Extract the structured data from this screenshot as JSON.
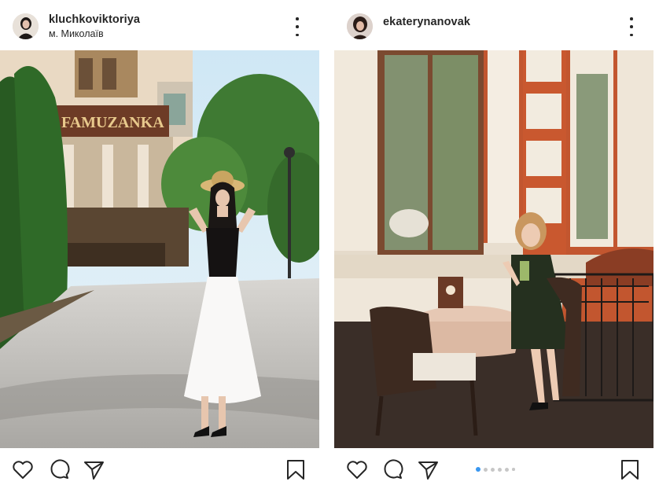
{
  "posts": [
    {
      "username": "kluchkoviktoriya",
      "location": "м. Миколаїв",
      "photo": {
        "sign_text": "FAMUZANKA",
        "description_icon": "woman-street-photo"
      },
      "actions": [
        "heart-icon",
        "comment-icon",
        "share-icon",
        "bookmark-icon"
      ]
    },
    {
      "username": "ekaterynanovak",
      "photo": {
        "description_icon": "woman-cafe-photo"
      },
      "carousel": {
        "count": 6,
        "active": 1
      },
      "actions": [
        "heart-icon",
        "comment-icon",
        "share-icon",
        "bookmark-icon"
      ]
    }
  ],
  "colors": {
    "text": "#262626",
    "carousel_active": "#3897f0",
    "carousel_inactive": "#c7c7c7"
  }
}
